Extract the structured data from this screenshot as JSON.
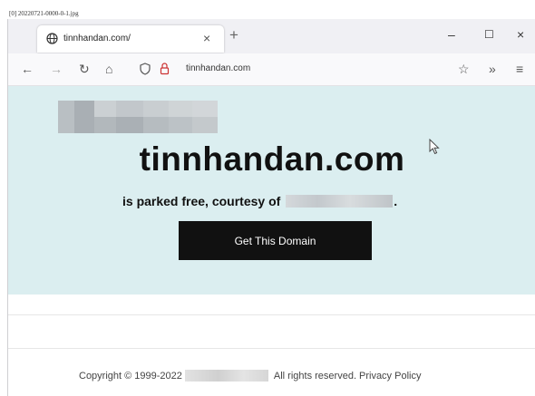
{
  "file_label": "[0] 20220721-0000-0-1.jpg",
  "browser": {
    "tab_title": "tinnhandan.com/",
    "tab_close": "×",
    "new_tab": "+",
    "window_controls": {
      "minimize": "–",
      "maximize": "☐",
      "close": "×"
    },
    "address": "tinnhandan.com",
    "nav": {
      "back": "←",
      "forward": "→",
      "reload": "↻",
      "home": "⌂"
    },
    "toolbar_right": {
      "bookmark": "☆",
      "overflow": "»",
      "menu": "≡"
    }
  },
  "page": {
    "domain": "tinnhandan.com",
    "parked_text": "is parked free, courtesy of",
    "parked_suffix": ".",
    "cta_label": "Get This Domain",
    "background_color": "#dbeef0"
  },
  "footer": {
    "copyright": "Copyright © 1999-2022",
    "rights": "All rights reserved.",
    "privacy": "Privacy Policy"
  }
}
